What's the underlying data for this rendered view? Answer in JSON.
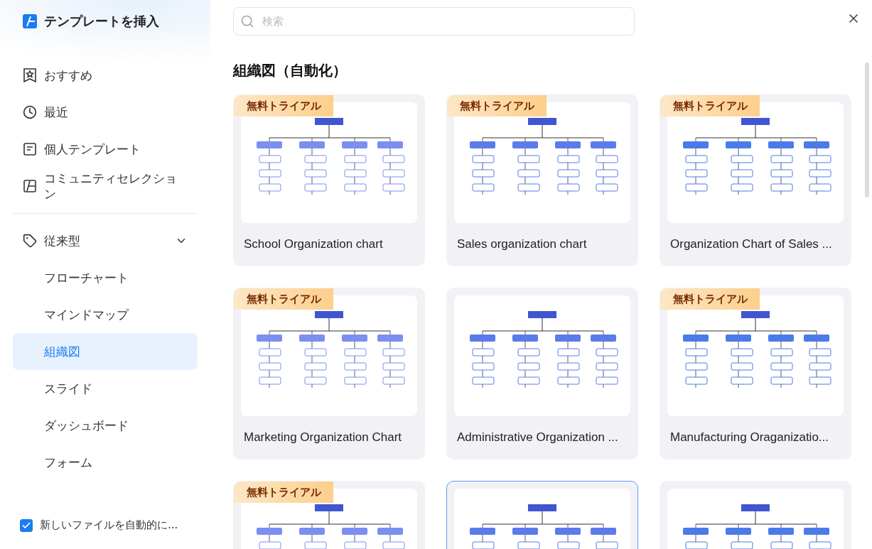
{
  "app": {
    "title": "テンプレートを挿入"
  },
  "sidebar": {
    "items": [
      {
        "label": "おすすめ",
        "selected": false
      },
      {
        "label": "最近",
        "selected": false
      },
      {
        "label": "個人テンプレート",
        "selected": false
      },
      {
        "label": "コミュニティセレクション",
        "selected": false
      }
    ],
    "group": {
      "label": "従来型",
      "expanded": true,
      "children": [
        {
          "label": "フローチャート",
          "selected": false
        },
        {
          "label": "マインドマップ",
          "selected": false
        },
        {
          "label": "組織図",
          "selected": true
        },
        {
          "label": "スライド",
          "selected": false
        },
        {
          "label": "ダッシュボード",
          "selected": false
        },
        {
          "label": "フォーム",
          "selected": false
        }
      ]
    },
    "auto_open": {
      "label": "新しいファイルを自動的に...",
      "checked": true
    }
  },
  "search": {
    "placeholder": "検索"
  },
  "section_title": "組織図（自動化）",
  "templates": [
    {
      "title": "School Organization chart",
      "badge": "無料トライアル",
      "selected": false
    },
    {
      "title": "Sales organization chart",
      "badge": "無料トライアル",
      "selected": false
    },
    {
      "title": "Organization Chart of Sales ...",
      "badge": "無料トライアル",
      "selected": false
    },
    {
      "title": "Marketing Organization Chart",
      "badge": "無料トライアル",
      "selected": false
    },
    {
      "title": "Administrative Organization ...",
      "selected": false
    },
    {
      "title": "Manufacturing Oraganizatio...",
      "badge": "無料トライアル",
      "selected": false
    },
    {
      "badge": "無料トライアル",
      "selected": false
    },
    {
      "selected": true
    },
    {
      "selected": false
    }
  ]
}
